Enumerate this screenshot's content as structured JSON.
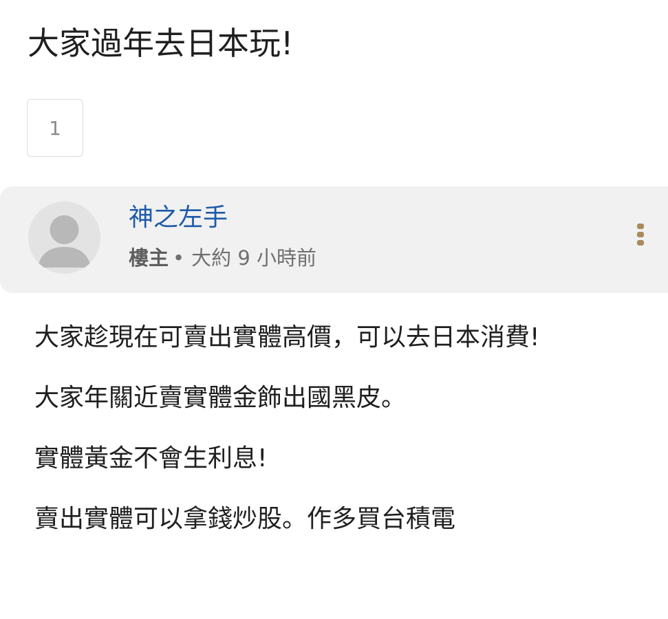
{
  "thread": {
    "title": "大家過年去日本玩!"
  },
  "pagination": {
    "current_page": "1"
  },
  "post": {
    "author_name": "神之左手",
    "role_label": "樓主",
    "separator": "•",
    "time_ago": "大約 9 小時前",
    "more_icon": "vertical-ellipsis-icon",
    "more_icon_color": "#a88a5c",
    "author_color": "#1e5aa8",
    "body_lines": [
      "大家趁現在可賣出實體高價，可以去日本消費!",
      "大家年關近賣實體金飾出國黑皮。",
      "實體黃金不會生利息!",
      "賣出實體可以拿錢炒股。作多買台積電"
    ]
  }
}
